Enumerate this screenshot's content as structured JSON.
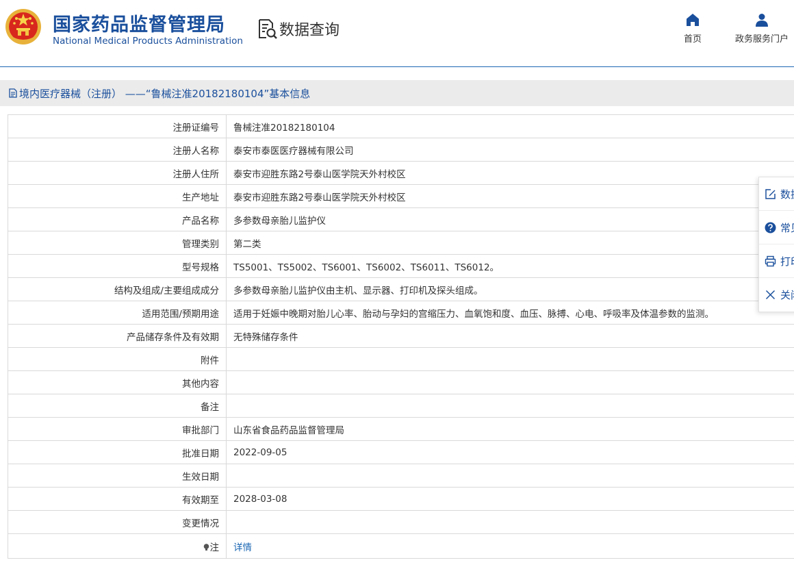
{
  "header": {
    "title_cn": "国家药品监督管理局",
    "title_en": "National Medical Products Administration",
    "query_title": "数据查询",
    "nav": [
      {
        "label": "首页",
        "icon": "home-icon"
      },
      {
        "label": "政务服务门户",
        "icon": "user-icon"
      }
    ]
  },
  "breadcrumb": {
    "text": "境内医疗器械（注册） ——“鲁械注准20182180104”基本信息"
  },
  "table": {
    "rows": [
      {
        "label": "注册证编号",
        "value": "鲁械注准20182180104"
      },
      {
        "label": "注册人名称",
        "value": "泰安市泰医医疗器械有限公司"
      },
      {
        "label": "注册人住所",
        "value": "泰安市迎胜东路2号泰山医学院天外村校区"
      },
      {
        "label": "生产地址",
        "value": "泰安市迎胜东路2号泰山医学院天外村校区"
      },
      {
        "label": "产品名称",
        "value": "多参数母亲胎儿监护仪"
      },
      {
        "label": "管理类别",
        "value": "第二类"
      },
      {
        "label": "型号规格",
        "value": "TS5001、TS5002、TS6001、TS6002、TS6011、TS6012。"
      },
      {
        "label": "结构及组成/主要组成成分",
        "value": "多参数母亲胎儿监护仪由主机、显示器、打印机及探头组成。"
      },
      {
        "label": "适用范围/预期用途",
        "value": "适用于妊娠中晚期对胎儿心率、胎动与孕妇的宫缩压力、血氧饱和度、血压、脉搏、心电、呼吸率及体温参数的监测。"
      },
      {
        "label": "产品储存条件及有效期",
        "value": "无特殊储存条件"
      },
      {
        "label": "附件",
        "value": ""
      },
      {
        "label": "其他内容",
        "value": ""
      },
      {
        "label": "备注",
        "value": ""
      },
      {
        "label": "审批部门",
        "value": "山东省食品药品监督管理局"
      },
      {
        "label": "批准日期",
        "value": "2022-09-05"
      },
      {
        "label": "生效日期",
        "value": ""
      },
      {
        "label": "有效期至",
        "value": "2028-03-08"
      },
      {
        "label": "变更情况",
        "value": ""
      }
    ],
    "note_label": "注",
    "note_link": "详情"
  },
  "side_panel": {
    "items": [
      {
        "label": "数据",
        "icon": "edit-icon"
      },
      {
        "label": "常见",
        "icon": "help-icon"
      },
      {
        "label": "打印",
        "icon": "print-icon"
      },
      {
        "label": "关闭",
        "icon": "close-icon"
      }
    ]
  },
  "colors": {
    "brand_blue": "#1a4f9c",
    "link_blue": "#1a66b3",
    "crumb_bg": "#ebebeb",
    "border": "#d9d9d9"
  }
}
